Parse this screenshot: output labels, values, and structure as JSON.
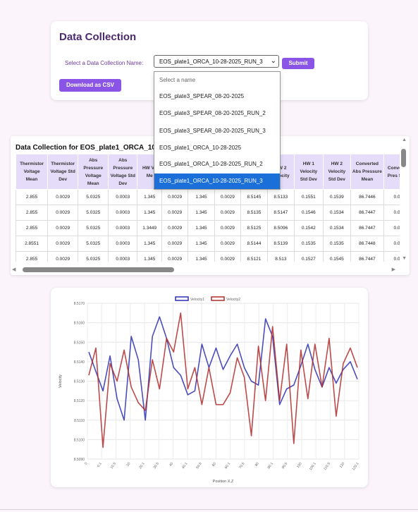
{
  "header": {
    "title": "Data Collection",
    "select_label": "Select a Data Collection Name:",
    "select_value": "EOS_plate1_ORCA_10-28-2025_RUN_3",
    "submit_label": "Submit",
    "csv_label": "Download as CSV"
  },
  "dropdown": {
    "options": [
      "Select a name",
      "EOS_plate3_SPEAR_08-20-2025",
      "EOS_plate3_SPEAR_08-20-2025_RUN_2",
      "EOS_plate3_SPEAR_08-20-2025_RUN_3",
      "EOS_plate1_ORCA_10-28-2025",
      "EOS_plate1_ORCA_10-28-2025_RUN_2",
      "EOS_plate1_ORCA_10-28-2025_RUN_3"
    ],
    "selected_index": 6
  },
  "table": {
    "title": "Data Collection for EOS_plate1_ORCA_10",
    "columns": [
      "Thermistor Voltage Mean",
      "Thermistor Voltage Std Dev",
      "Abs Pressure Voltage Mean",
      "Abs Pressure Voltage Std Dev",
      "HW Vo Me",
      "",
      "",
      "",
      "",
      "HW 2 Velocity",
      "HW 1 Velocity Std Dev",
      "HW 2 Velocity Std Dev",
      "Converted Abs Pressure Mean",
      "Conve A Pres Std"
    ],
    "rows": [
      [
        "2.855",
        "0.0029",
        "5.0325",
        "0.0003",
        "1.345",
        "0.0029",
        "1.345",
        "0.0029",
        "8.5145",
        "8.5133",
        "0.1551",
        "0.1539",
        "86.7446",
        "0.0"
      ],
      [
        "2.855",
        "0.0029",
        "5.0325",
        "0.0003",
        "1.345",
        "0.0029",
        "1.345",
        "0.0029",
        "8.5135",
        "8.5147",
        "0.1546",
        "0.1534",
        "86.7447",
        "0.0"
      ],
      [
        "2.855",
        "0.0029",
        "5.0325",
        "0.0003",
        "1.3449",
        "0.0029",
        "1.345",
        "0.0029",
        "8.5125",
        "8.5096",
        "0.1542",
        "0.1534",
        "86.7447",
        "0.0"
      ],
      [
        "2.8551",
        "0.0029",
        "5.0325",
        "0.0003",
        "1.345",
        "0.0029",
        "1.345",
        "0.0029",
        "8.5144",
        "8.5139",
        "0.1535",
        "0.1535",
        "86.7448",
        "0.0"
      ],
      [
        "2.855",
        "0.0029",
        "5.0325",
        "0.0003",
        "1.345",
        "0.0029",
        "1.345",
        "0.0029",
        "8.5121",
        "8.513",
        "0.1527",
        "0.1545",
        "86.7447",
        "0.0"
      ]
    ]
  },
  "colors": {
    "accent": "#8a55e6",
    "title": "#4b2a6e",
    "header_bg": "#e4dcf9",
    "selected_option": "#1a6fd8",
    "series1": "#2b2fb0",
    "series2": "#b02b2b"
  },
  "icons": {
    "select_chevron": "chevron-down-icon",
    "scroll_up": "triangle-up-icon",
    "scroll_down": "triangle-down-icon",
    "scroll_left": "triangle-left-icon",
    "scroll_right": "triangle-right-icon"
  },
  "chart_data": {
    "type": "line",
    "title": "",
    "xlabel": "Position X,Z",
    "ylabel": "Velocity",
    "ylim": [
      8.509,
      8.517
    ],
    "yticks": [
      8.509,
      8.51,
      8.511,
      8.512,
      8.513,
      8.514,
      8.515,
      8.516,
      8.517
    ],
    "ytick_labels": [
      "8.5090",
      "8.5100",
      "8.5110",
      "8.5120",
      "8.5130",
      "8.5140",
      "8.5150",
      "8.5160",
      "8.5170"
    ],
    "xtick_labels": [
      "0",
      "0.1",
      "10.5",
      "20",
      "20.1",
      "30.5",
      "40",
      "40.1",
      "50.5",
      "60",
      "60.1",
      "70.5",
      "80",
      "80.1",
      "90.5",
      "100",
      "100.1",
      "110.5",
      "120",
      "120.1"
    ],
    "grid": true,
    "legend": "top-center",
    "series": [
      {
        "name": "Velocity1",
        "values": [
          8.5145,
          8.5135,
          8.5125,
          8.5143,
          8.5121,
          8.511,
          8.5153,
          8.5141,
          8.511,
          8.5153,
          8.5163,
          8.5152,
          8.5137,
          8.5133,
          8.5123,
          8.5125,
          8.5149,
          8.5137,
          8.5147,
          8.5136,
          8.5143,
          8.5149,
          8.5137,
          8.513,
          8.5128,
          8.5162,
          8.5153,
          8.5118,
          8.5126,
          8.5128,
          8.5138,
          8.5149,
          8.5136,
          8.5127,
          8.5137,
          8.5129,
          8.5136,
          8.514,
          8.5131
        ]
      },
      {
        "name": "Velocity2",
        "values": [
          8.5133,
          8.5147,
          8.5096,
          8.5139,
          8.513,
          8.5146,
          8.5127,
          8.5119,
          8.5115,
          8.5141,
          8.5126,
          8.5152,
          8.5145,
          8.5165,
          8.5126,
          8.5137,
          8.5118,
          8.5137,
          8.5118,
          8.5118,
          8.5124,
          8.5142,
          8.5132,
          8.5102,
          8.5148,
          8.512,
          8.5158,
          8.512,
          8.5149,
          8.5098,
          8.5146,
          8.5121,
          8.5149,
          8.5127,
          8.5152,
          8.5112,
          8.5139,
          8.5147,
          8.5137
        ]
      }
    ]
  }
}
